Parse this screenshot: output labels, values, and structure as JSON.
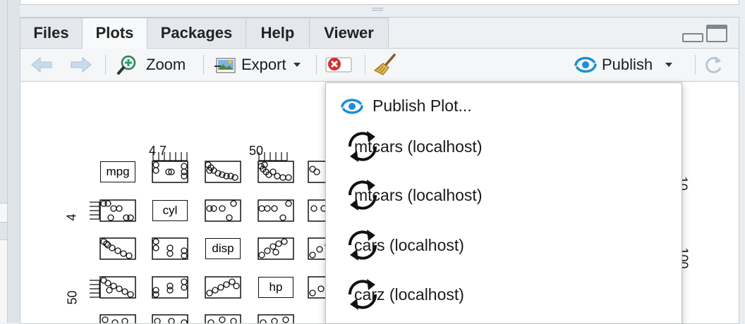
{
  "tabs": [
    {
      "label": "Files",
      "active": false
    },
    {
      "label": "Plots",
      "active": true
    },
    {
      "label": "Packages",
      "active": false
    },
    {
      "label": "Help",
      "active": false
    },
    {
      "label": "Viewer",
      "active": false
    }
  ],
  "toolbar": {
    "back_icon": "arrow-left-icon",
    "forward_icon": "arrow-right-icon",
    "zoom_label": "Zoom",
    "export_label": "Export",
    "remove_icon": "remove-plot-icon",
    "clear_icon": "broom-icon",
    "publish_label": "Publish",
    "refresh_icon": "refresh-icon"
  },
  "plot": {
    "variables": [
      "mpg",
      "cyl",
      "disp",
      "hp"
    ],
    "top_ticks": {
      "cyl": "4   7",
      "hp": "50"
    },
    "left_ticks": {
      "cyl": "4",
      "hp": "50"
    },
    "right_ticks": [
      "10",
      "100"
    ]
  },
  "dropdown": {
    "publish_plot_label": "Publish Plot...",
    "items": [
      {
        "label": "mtcars (localhost)"
      },
      {
        "label": "mtcars (localhost)"
      },
      {
        "label": "cars (localhost)"
      },
      {
        "label": "carz (localhost)"
      }
    ]
  },
  "colors": {
    "accent": "#1a8fd8",
    "remove_red": "#d62d2d",
    "tab_bg": "#e4e8ec",
    "toolbar_bg": "#f4f6f8"
  }
}
